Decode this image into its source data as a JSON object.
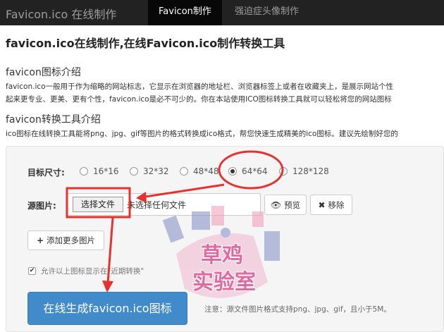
{
  "navbar": {
    "brand": "Favicon.ico 在线制作",
    "tabs": [
      {
        "label": "Favicon制作",
        "active": true
      },
      {
        "label": "强迫症头像制作",
        "active": false
      }
    ]
  },
  "main": {
    "title": "favicon.ico在线制作,在线Favicon.ico制作转换工具",
    "intro_title": "favicon图标介绍",
    "intro_lines": [
      "favicon.ico一般用于作为缩略的网站标志，它显示在浏览器的地址栏、浏览器标签上或者在收藏夹上，是展示网站个性",
      "起来更专业、更美、更有个性，favicon.ico是必不可少的。你在本站使用ICO图标转换工具就可以轻松将您的网站图标"
    ],
    "tool_title": "favicon转换工具介绍",
    "tool_line": "ico图标在线转换工具能将png、jpg、gif等图片的格式转换成ico格式，帮您快速生成精美的ico图标。建议先绘制好您的"
  },
  "form": {
    "size_label": "目标尺寸:",
    "sizes": [
      {
        "label": "16*16",
        "checked": false
      },
      {
        "label": "32*32",
        "checked": false
      },
      {
        "label": "48*48",
        "checked": false
      },
      {
        "label": "64*64",
        "checked": true
      },
      {
        "label": "128*128",
        "checked": false
      }
    ],
    "source_label": "源图片:",
    "choose_file": "选择文件",
    "no_file": "未选择任何文件",
    "preview": "预览",
    "remove": "移除",
    "add_more": "添加更多图片",
    "allow_label": "允许以上图标显示在\"近期转换\"",
    "allow_checked": true,
    "submit": "在线生成favicon.ico图标",
    "note": "注意：源文件图片格式支持png、jpg、gif，且小于5M。"
  },
  "watermark_text": "草鸡实验室",
  "colors": {
    "navbar_bg": "#222222",
    "primary": "#428bca",
    "annotation_red": "#e8312f"
  },
  "icons": {
    "preview": "eye-icon",
    "remove": "x-icon",
    "add": "plus-icon",
    "check": "check-icon"
  }
}
